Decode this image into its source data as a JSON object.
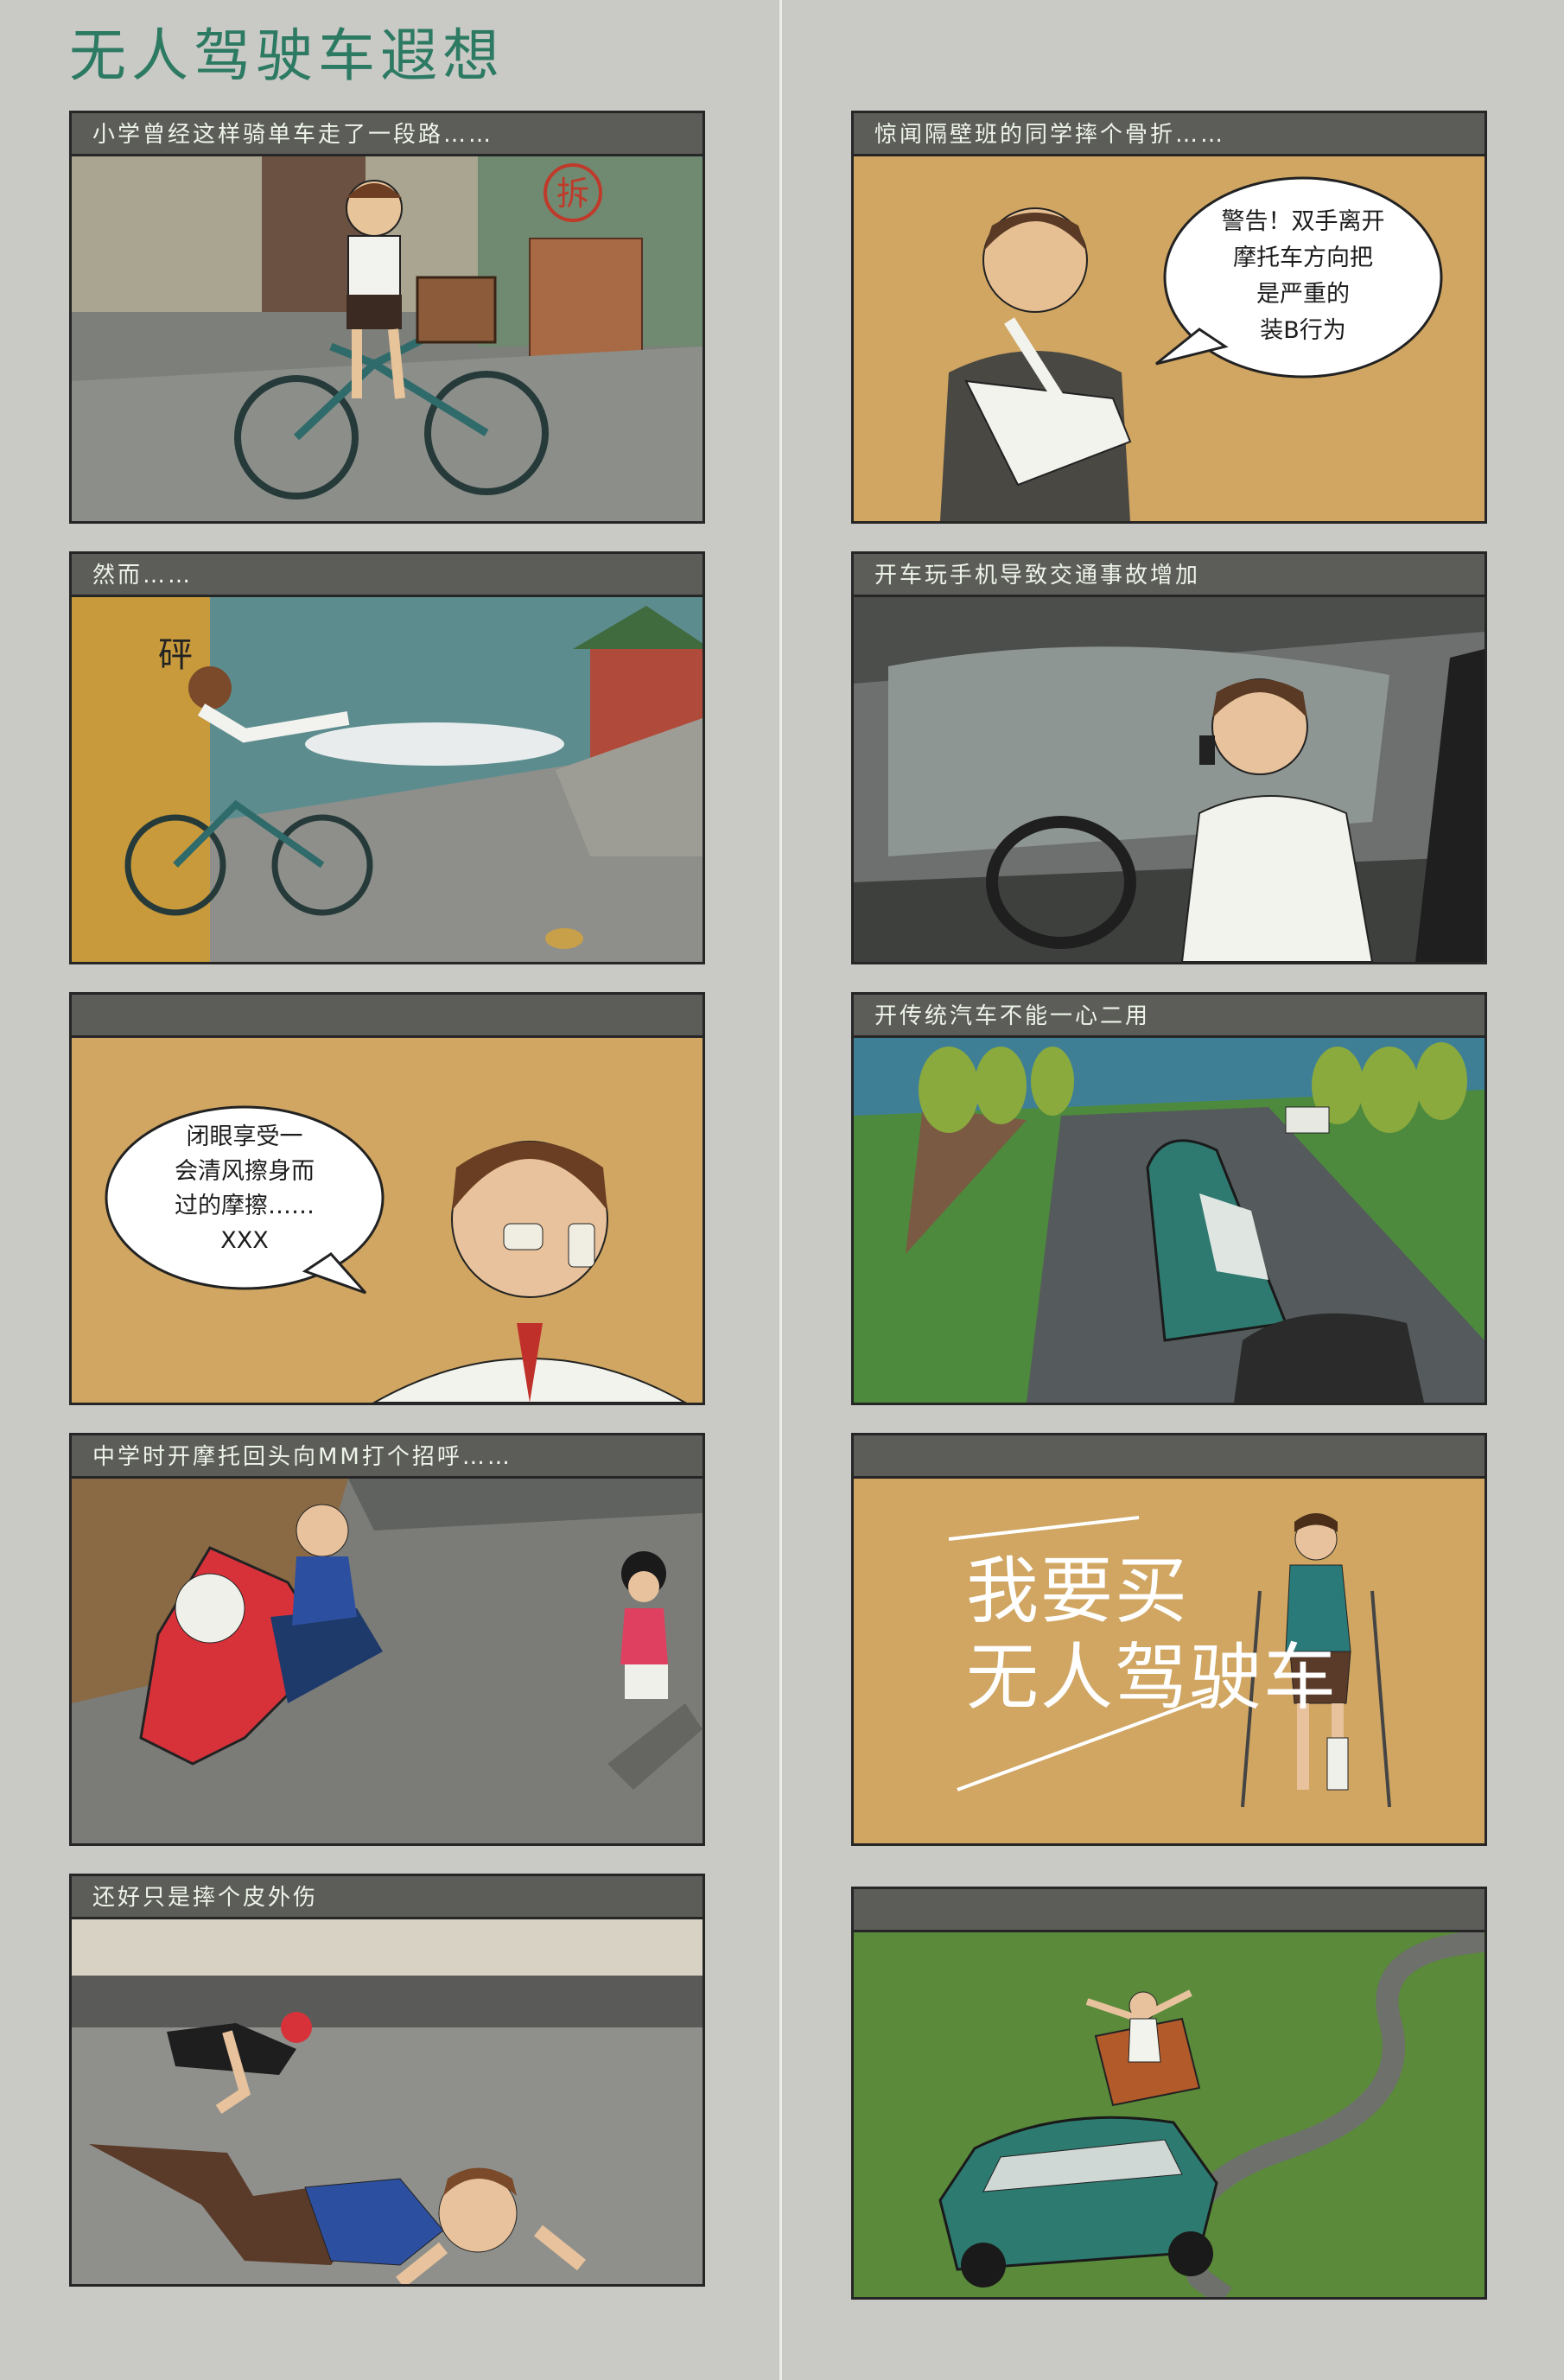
{
  "title": "无人驾驶车遐想",
  "panels": [
    {
      "caption": "小学曾经这样骑单车走了一段路……",
      "sign": "拆"
    },
    {
      "caption": "惊闻隔壁班的同学摔个骨折……",
      "bubble": [
        "警告！双手离开",
        "摩托车方向把",
        "是严重的",
        "装B行为"
      ]
    },
    {
      "caption": "然而……",
      "sfx": "砰"
    },
    {
      "caption": "开车玩手机导致交通事故增加"
    },
    {
      "caption": "",
      "bubble": [
        "闭眼享受一",
        "会清风擦身而",
        "过的摩擦……",
        "XXX"
      ]
    },
    {
      "caption": "开传统汽车不能一心二用"
    },
    {
      "caption": "中学时开摩托回头向MM打个招呼……"
    },
    {
      "caption": "",
      "slogan": [
        "我要买",
        "无人驾驶车"
      ]
    },
    {
      "caption": "还好只是摔个皮外伤"
    },
    {
      "caption": ""
    }
  ]
}
